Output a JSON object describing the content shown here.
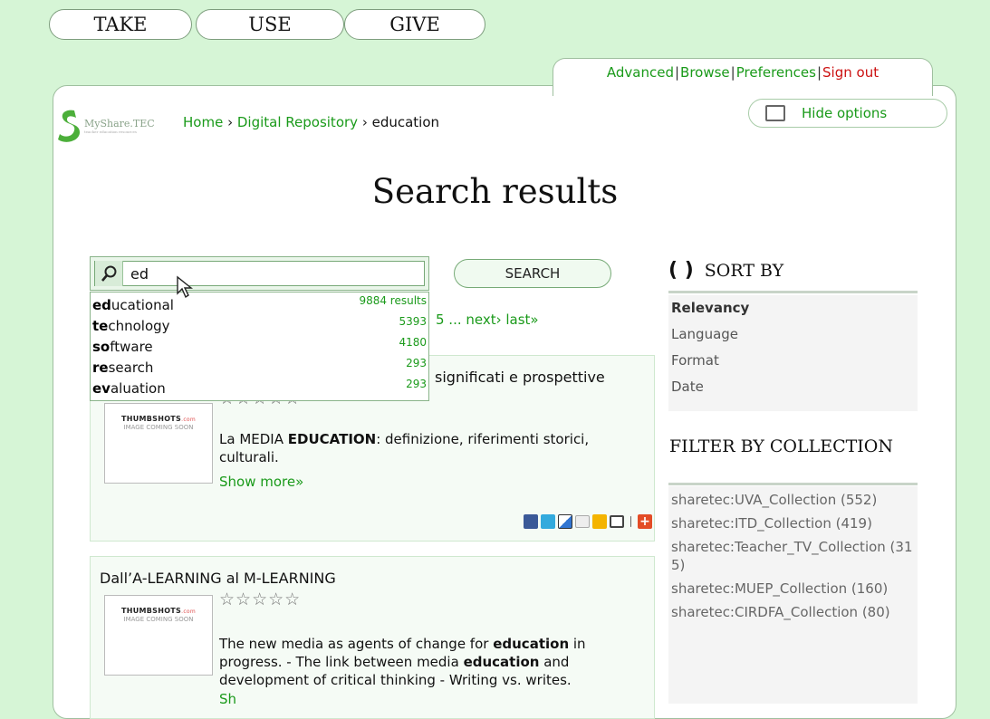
{
  "nav": {
    "take": "TAKE",
    "use": "USE",
    "give": "GIVE"
  },
  "top_links": {
    "advanced": "Advanced",
    "browse": "Browse",
    "preferences": "Preferences",
    "signout": "Sign out"
  },
  "logo": {
    "text": "MyShare.TEC",
    "tagline": "teacher education resources"
  },
  "breadcrumb": {
    "home": "Home",
    "repo": "Digital Repository",
    "current": "education",
    "sep": "›"
  },
  "hide_options": "Hide options",
  "page_title": "Search results",
  "search": {
    "value": "ed",
    "button": "SEARCH"
  },
  "suggestions": [
    {
      "prefix": "ed",
      "rest": "ucational",
      "count": "9884 results"
    },
    {
      "prefix": "te",
      "rest": "chnology",
      "count": "5393"
    },
    {
      "prefix": "so",
      "rest": "ftware",
      "count": "4180"
    },
    {
      "prefix": "re",
      "rest": "search",
      "count": "293"
    },
    {
      "prefix": "ev",
      "rest": "aluation",
      "count": "293"
    }
  ],
  "pager": "5 ... next› last»",
  "results": [
    {
      "title_tail": "significati e prospettive",
      "desc_pre": "La MEDIA ",
      "desc_bold": "EDUCATION",
      "desc_post": ": definizione, riferimenti storici, culturali.",
      "more": "Show more»",
      "stars": "☆☆☆☆☆"
    },
    {
      "title": "Dall’A-LEARNING al M-LEARNING",
      "stars": "☆☆☆☆☆",
      "d1": "The new media as agents of change for ",
      "d2": "education",
      "d3": " in progress. - The link between media ",
      "d4": "education",
      "d5": " and development of critical thinking - Writing vs. writes.",
      "more": "Sh"
    }
  ],
  "thumb": {
    "brand": "THUMBSHOTS",
    "brand_suffix": ".com",
    "caption": "IMAGE COMING SOON"
  },
  "sort": {
    "heading": "SORT BY",
    "options": [
      "Relevancy",
      "Language",
      "Format",
      "Date"
    ],
    "selected": "Relevancy"
  },
  "filter": {
    "heading": "FILTER BY COLLECTION",
    "items": [
      "sharetec:UVA_Collection (552)",
      "sharetec:ITD_Collection (419)",
      "sharetec:Teacher_TV_Collection (315)",
      "sharetec:MUEP_Collection (160)",
      "sharetec:CIRDFA_Collection (80)"
    ]
  },
  "colors": {
    "background": "#d6f5d6",
    "link": "#1a9a1a",
    "signout": "#cc1111"
  }
}
